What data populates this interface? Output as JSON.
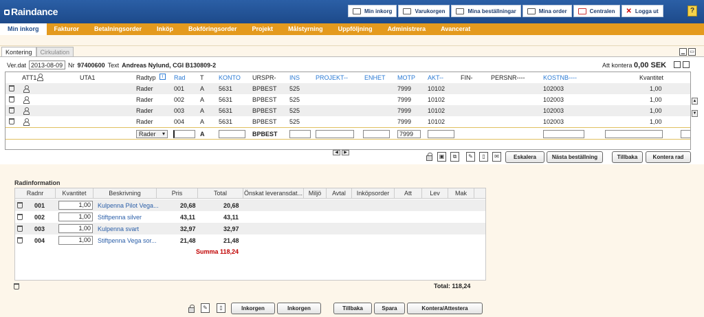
{
  "app": {
    "logo": "Raindance"
  },
  "topbar": {
    "buttons": [
      "Min inkorg",
      "Varukorgen",
      "Mina beställningar",
      "Mina order",
      "Centralen",
      "Logga ut"
    ],
    "help": "?"
  },
  "nav": [
    "Min inkorg",
    "Fakturor",
    "Betalningsorder",
    "Inköp",
    "Bokföringsorder",
    "Projekt",
    "Målstyrning",
    "Uppföljning",
    "Administrera",
    "Avancerat"
  ],
  "tabs": [
    "Kontering",
    "Cirkulation"
  ],
  "meta": {
    "verdat_label": "Ver.dat",
    "verdat_value": "2013-08-09",
    "nr_label": "Nr",
    "nr_value": "97400600",
    "text_label": "Text",
    "text_value": "Andreas Nylund, CGI B130809-2",
    "att_label": "Att kontera",
    "att_value": "0,00 SEK"
  },
  "grid": {
    "headers": [
      "ATT1",
      "UTA1",
      "Radtyp",
      "Rad",
      "T",
      "KONTO",
      "URSPR-",
      "INS",
      "PROJEKT--",
      "ENHET",
      "MOTP",
      "AKT--",
      "FIN-",
      "PERSNR----",
      "KOSTNB----",
      "Kvantitet"
    ],
    "rows": [
      {
        "radtyp": "Rader",
        "rad": "001",
        "t": "A",
        "konto": "5631",
        "urspr": "BPBEST",
        "ins": "525",
        "motp": "7999",
        "akt": "10102",
        "kostnb": "102003",
        "kvantitet": "1,00"
      },
      {
        "radtyp": "Rader",
        "rad": "002",
        "t": "A",
        "konto": "5631",
        "urspr": "BPBEST",
        "ins": "525",
        "motp": "7999",
        "akt": "10102",
        "kostnb": "102003",
        "kvantitet": "1,00"
      },
      {
        "radtyp": "Rader",
        "rad": "003",
        "t": "A",
        "konto": "5631",
        "urspr": "BPBEST",
        "ins": "525",
        "motp": "7999",
        "akt": "10102",
        "kostnb": "102003",
        "kvantitet": "1,00"
      },
      {
        "radtyp": "Rader",
        "rad": "004",
        "t": "A",
        "konto": "5631",
        "urspr": "BPBEST",
        "ins": "525",
        "motp": "7999",
        "akt": "10102",
        "kostnb": "102003",
        "kvantitet": "1,00"
      }
    ],
    "input_row": {
      "radtyp": "Rader",
      "t": "A",
      "urspr": "BPBEST",
      "motp": "7999"
    }
  },
  "grid_buttons": [
    "Eskalera",
    "Nästa beställning",
    "Tillbaka",
    "Kontera rad"
  ],
  "radinfo": {
    "title": "Radinformation",
    "headers": [
      "Radnr",
      "Kvantitet",
      "Beskrivning",
      "Pris",
      "Total",
      "Önskat leveransdat...",
      "Miljö",
      "Avtal",
      "Inköpsorder",
      "Att",
      "Lev",
      "Mak"
    ],
    "rows": [
      {
        "radnr": "001",
        "kvantitet": "1,00",
        "beskrivning": "Kulpenna Pilot Vega...",
        "pris": "20,68",
        "total": "20,68"
      },
      {
        "radnr": "002",
        "kvantitet": "1,00",
        "beskrivning": "Stiftpenna silver",
        "pris": "43,11",
        "total": "43,11"
      },
      {
        "radnr": "003",
        "kvantitet": "1,00",
        "beskrivning": "Kulpenna svart",
        "pris": "32,97",
        "total": "32,97"
      },
      {
        "radnr": "004",
        "kvantitet": "1,00",
        "beskrivning": "Stiftpenna Vega sor...",
        "pris": "21,48",
        "total": "21,48"
      }
    ],
    "summa": "Summa 118,24",
    "total": "Total: 118,24"
  },
  "bottom_buttons": [
    "Inkorgen",
    "Inkorgen",
    "Tillbaka",
    "Spara",
    "Kontera/Attestera"
  ]
}
